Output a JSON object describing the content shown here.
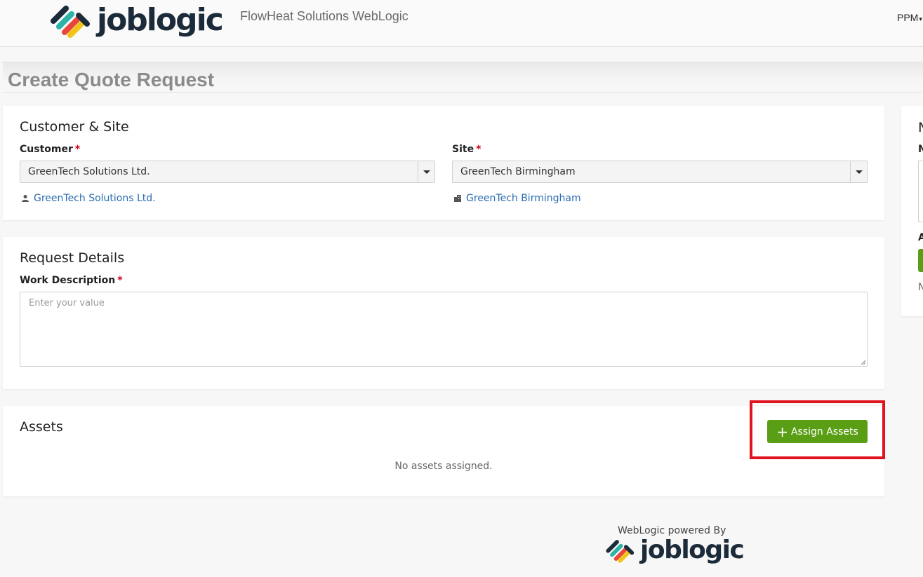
{
  "header": {
    "brand": "joblogic",
    "company_name": "FlowHeat Solutions WebLogic",
    "user_menu": "PPM"
  },
  "page": {
    "title": "Create Quote Request"
  },
  "customer_site": {
    "heading": "Customer & Site",
    "customer_label": "Customer",
    "customer_value": "GreenTech Solutions Ltd.",
    "customer_link": "GreenTech Solutions Ltd.",
    "site_label": "Site",
    "site_value": "GreenTech Birmingham",
    "site_link": "GreenTech Birmingham",
    "required_mark": "*"
  },
  "request_details": {
    "heading": "Request Details",
    "work_description_label": "Work Description",
    "work_description_placeholder": "Enter your value",
    "work_description_value": "",
    "required_mark": "*"
  },
  "assets": {
    "heading": "Assets",
    "assign_button": "Assign Assets",
    "empty_message": "No assets assigned."
  },
  "side_panel": {
    "heading_initial": "N",
    "label_initial": "N",
    "label2_initial": "A",
    "note_initial": "N"
  },
  "footer": {
    "powered_by": "WebLogic powered By",
    "brand": "joblogic"
  },
  "colors": {
    "accent_green": "#5a9e15",
    "link_blue": "#2a6db0",
    "required_red": "#d0021b",
    "highlight_red": "#e0141e"
  }
}
